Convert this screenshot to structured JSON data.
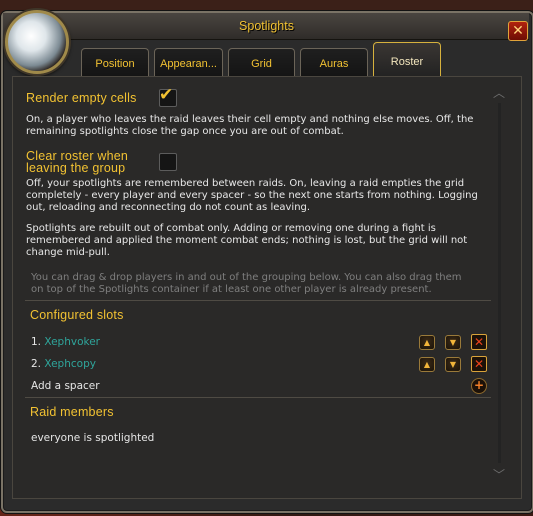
{
  "window": {
    "title": "Spotlights",
    "close_label": "✕"
  },
  "tabs": [
    {
      "label": "Position"
    },
    {
      "label": "Appearan..."
    },
    {
      "label": "Grid"
    },
    {
      "label": "Auras"
    },
    {
      "label": "Roster"
    }
  ],
  "active_tab": "Roster",
  "render_empty": {
    "label": "Render empty cells",
    "checked": true,
    "check_glyph": "✔",
    "desc_lines": [
      "On, a player who leaves the raid leaves their cell empty and nothing else moves. Off, the",
      "remaining spotlights close the gap once you are out of combat."
    ]
  },
  "clear_roster": {
    "label_line1": "Clear roster when",
    "label_line2": "leaving the group",
    "checked": false,
    "desc_lines": [
      "Off, your spotlights are remembered between raids. On, leaving a raid empties the grid",
      "completely - every player and every spacer - so the next one starts from nothing. Logging",
      "out, reloading and reconnecting do not count as leaving."
    ]
  },
  "rebuild_note": [
    "Spotlights are rebuilt out of combat only. Adding or removing one during a fight is",
    "remembered and applied the moment combat ends; nothing is lost, but the grid will not",
    "change mid-pull."
  ],
  "drag_hint": [
    "You can drag & drop players in and out of the grouping below. You can also drag them",
    "on top of the Spotlights container if at least one other player is already present."
  ],
  "configured_slots": {
    "heading": "Configured slots",
    "items": [
      {
        "index": "1.",
        "name": "Xephvoker"
      },
      {
        "index": "2.",
        "name": "Xephcopy"
      }
    ],
    "add_spacer_label": "Add a spacer"
  },
  "raid_members": {
    "heading": "Raid members",
    "empty_text": "everyone is spotlighted"
  },
  "colors": {
    "gold": "#f2c232",
    "slot_name": "#2fa59b",
    "close_red": "#b1220e"
  },
  "icons": {
    "up": "▲",
    "down": "▼",
    "remove": "✕",
    "add": "+",
    "scroll_up": "︿",
    "scroll_down": "﹀"
  }
}
